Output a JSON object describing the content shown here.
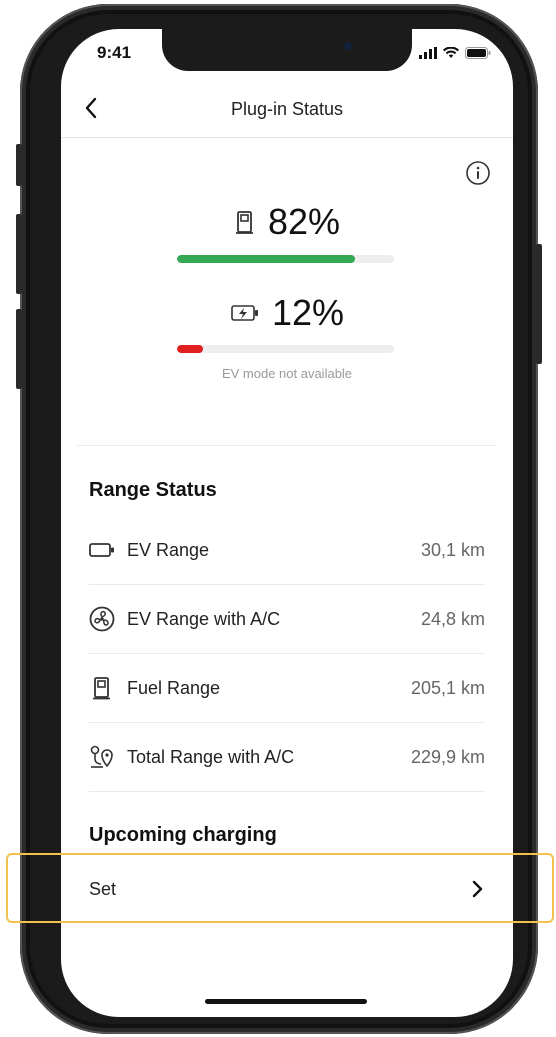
{
  "status_bar": {
    "time": "9:41"
  },
  "header": {
    "title": "Plug-in Status"
  },
  "fuel": {
    "percent_label": "82%",
    "level": 0.82,
    "color": "#34a853"
  },
  "battery": {
    "percent_label": "12%",
    "level": 0.12,
    "color": "#e02020",
    "note": "EV mode not available"
  },
  "range_status": {
    "title": "Range Status",
    "items": [
      {
        "icon": "battery-icon",
        "label": "EV Range",
        "value": "30,1 km"
      },
      {
        "icon": "fan-icon",
        "label": "EV Range with A/C",
        "value": "24,8 km"
      },
      {
        "icon": "fuel-pump-icon",
        "label": "Fuel Range",
        "value": "205,1 km"
      },
      {
        "icon": "route-pin-icon",
        "label": "Total Range with A/C",
        "value": "229,9 km"
      }
    ]
  },
  "upcoming_charging": {
    "title": "Upcoming charging",
    "set_label": "Set"
  },
  "colors": {
    "highlight": "#f2c14e"
  }
}
